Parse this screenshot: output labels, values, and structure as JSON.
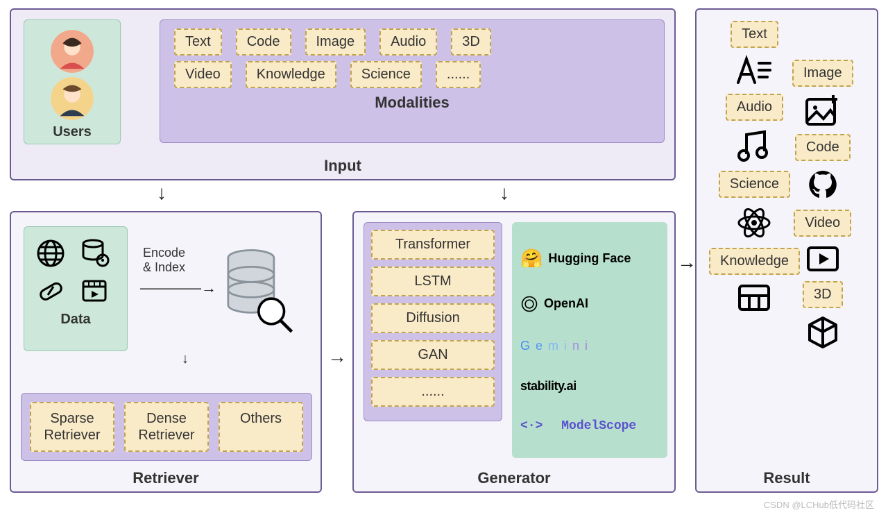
{
  "input": {
    "title": "Input",
    "users": "Users",
    "modalities_label": "Modalities",
    "row1": [
      "Text",
      "Code",
      "Image",
      "Audio",
      "3D"
    ],
    "row2": [
      "Video",
      "Knowledge",
      "Science",
      "......"
    ]
  },
  "retriever": {
    "title": "Retriever",
    "data_label": "Data",
    "encode_index": "Encode\n& Index",
    "types": [
      "Sparse Retriever",
      "Dense Retriever",
      "Others"
    ]
  },
  "generator": {
    "title": "Generator",
    "models": [
      "Transformer",
      "LSTM",
      "Diffusion",
      "GAN",
      "......"
    ],
    "brands": [
      "Hugging Face",
      "OpenAI",
      "Gemini",
      "stability.ai",
      "ModelScope"
    ]
  },
  "result": {
    "title": "Result",
    "left": [
      "Text",
      "Audio",
      "Science",
      "Knowledge"
    ],
    "right": [
      "Image",
      "Code",
      "Video",
      "3D"
    ]
  },
  "watermark": "CSDN @LCHub低代码社区"
}
